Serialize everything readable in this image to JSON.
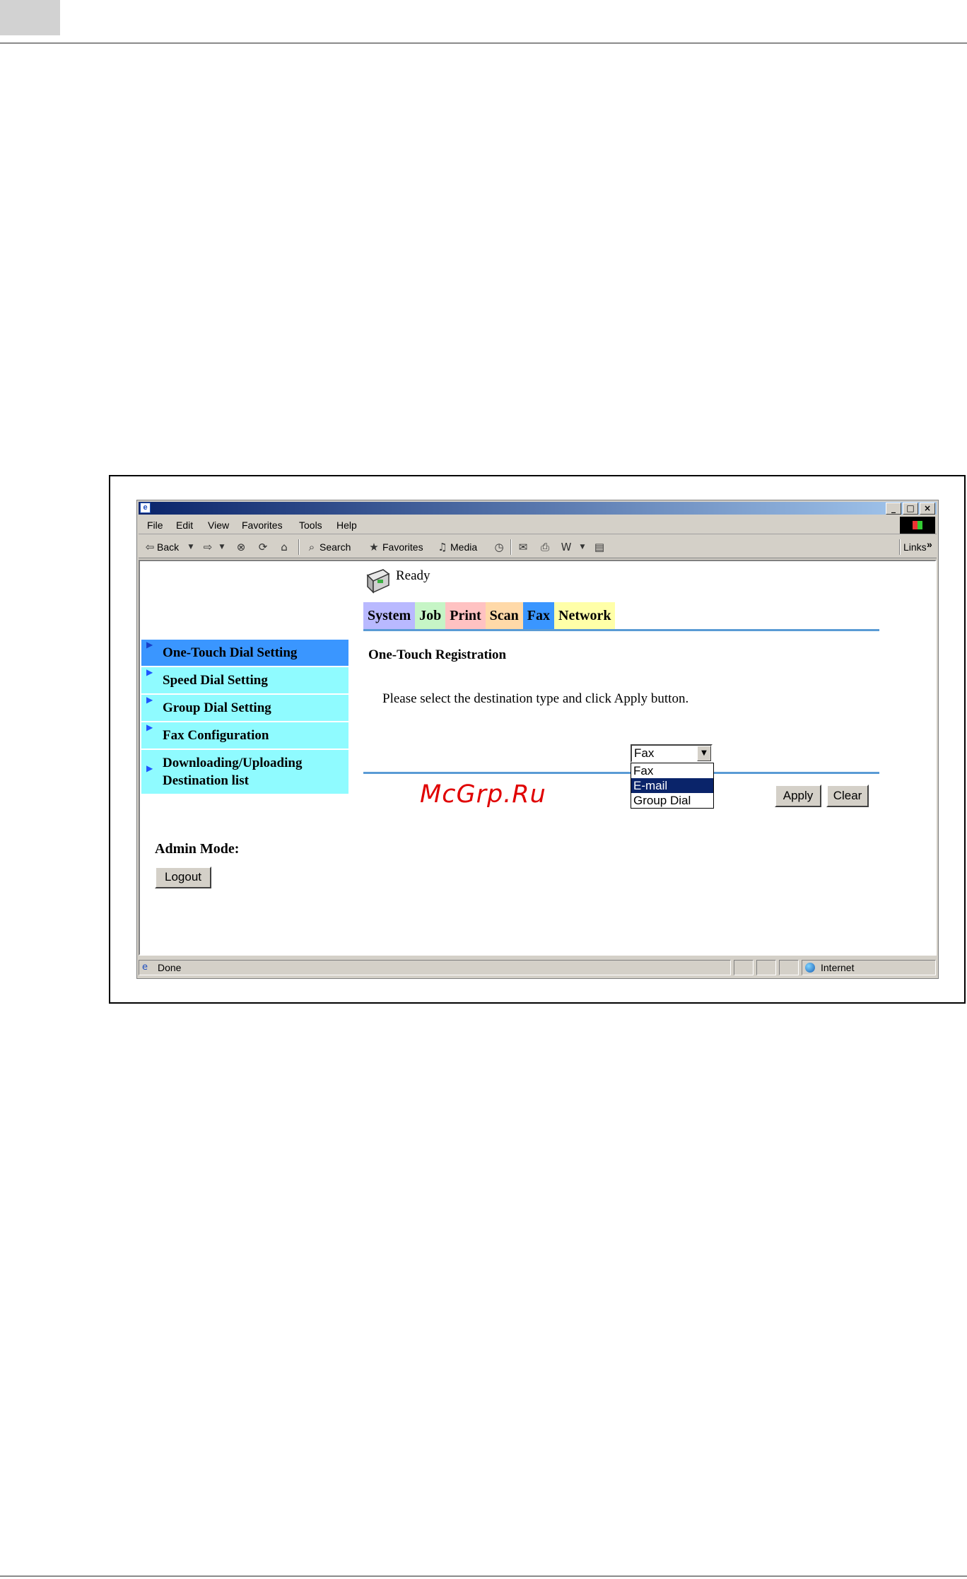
{
  "browser": {
    "menu": [
      "File",
      "Edit",
      "View",
      "Favorites",
      "Tools",
      "Help"
    ],
    "toolbar": {
      "back": "Back",
      "search": "Search",
      "favorites": "Favorites",
      "media": "Media",
      "links": "Links",
      "links_chevron": "»"
    },
    "status": {
      "text": "Done",
      "zone": "Internet"
    }
  },
  "page": {
    "status": "Ready",
    "tabs": [
      {
        "label": "System",
        "color": "#b9b9ff"
      },
      {
        "label": "Job",
        "color": "#c6f5c6"
      },
      {
        "label": "Print",
        "color": "#ffc2c2"
      },
      {
        "label": "Scan",
        "color": "#ffd9a8"
      },
      {
        "label": "Fax",
        "color": "#3a96ff"
      },
      {
        "label": "Network",
        "color": "#ffffa8"
      }
    ],
    "active_tab": "Fax",
    "sidebar": [
      {
        "label": "One-Touch Dial Setting",
        "active": true
      },
      {
        "label": "Speed Dial Setting"
      },
      {
        "label": "Group Dial Setting"
      },
      {
        "label": "Fax Configuration"
      },
      {
        "label": "Downloading/Uploading",
        "label2": "Destination list"
      }
    ],
    "admin_mode_label": "Admin Mode:",
    "logout_label": "Logout",
    "section_title": "One-Touch Registration",
    "instruction": "Please select the destination type and click Apply button.",
    "destination_select": {
      "value": "Fax",
      "options": [
        "Fax",
        "E-mail",
        "Group Dial"
      ],
      "highlighted": "E-mail"
    },
    "apply_label": "Apply",
    "clear_label": "Clear"
  },
  "watermark": "McGrp.Ru"
}
